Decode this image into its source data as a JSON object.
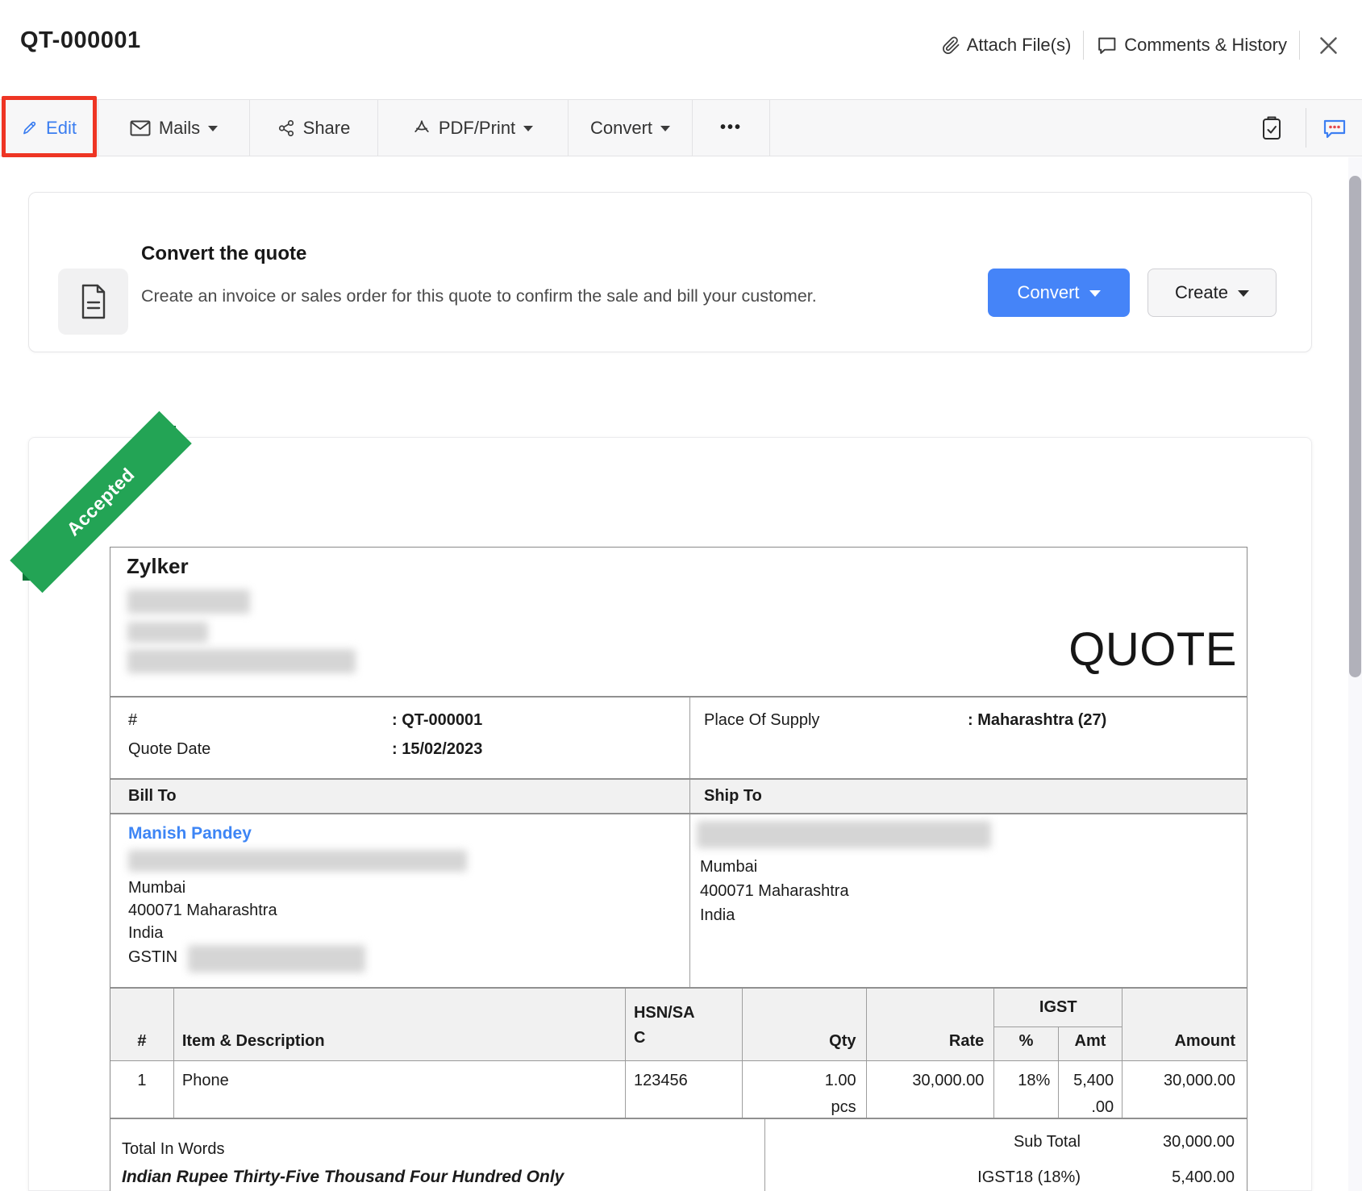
{
  "header": {
    "title": "QT-000001",
    "attach_label": "Attach File(s)",
    "comments_label": "Comments & History"
  },
  "toolbar": {
    "edit": "Edit",
    "mails": "Mails",
    "share": "Share",
    "pdf_print": "PDF/Print",
    "convert": "Convert",
    "more": "•••"
  },
  "banner": {
    "title": "Convert the quote",
    "description": "Create an invoice or sales order for this quote to confirm the sale and bill your customer.",
    "convert_button": "Convert",
    "create_button": "Create"
  },
  "ribbon": {
    "label": "Accepted",
    "color": "#23a455"
  },
  "document": {
    "company": "Zylker",
    "doc_type": "QUOTE",
    "details": {
      "number_label": "#",
      "number_value": ": QT-000001",
      "date_label": "Quote Date",
      "date_value": ": 15/02/2023",
      "place_label": "Place Of Supply",
      "place_value": ": Maharashtra (27)"
    },
    "bill_to": {
      "heading": "Bill To",
      "name": "Manish Pandey",
      "city": "Mumbai",
      "state": "400071 Maharashtra",
      "country": "India",
      "gstin_label": "GSTIN"
    },
    "ship_to": {
      "heading": "Ship To",
      "city": "Mumbai",
      "state": "400071 Maharashtra",
      "country": "India"
    },
    "items": {
      "col_sno": "#",
      "col_item": "Item & Description",
      "col_hsn": "HSN/SAC",
      "col_qty": "Qty",
      "col_rate": "Rate",
      "col_igst": "IGST",
      "col_pct": "%",
      "col_amt": "Amt",
      "col_amount": "Amount",
      "rows": [
        {
          "sno": "1",
          "name": "Phone",
          "hsn": "123456",
          "qty": "1.00",
          "unit": "pcs",
          "rate": "30,000.00",
          "igst_pct": "18%",
          "igst_amt_1": "5,400",
          "igst_amt_2": ".00",
          "amount": "30,000.00"
        }
      ]
    },
    "totals": {
      "words_label": "Total In Words",
      "words_value": "Indian Rupee Thirty-Five Thousand Four Hundred Only",
      "rows": [
        {
          "label": "Sub Total",
          "value": "30,000.00"
        },
        {
          "label": "IGST18 (18%)",
          "value": "5,400.00"
        }
      ]
    }
  }
}
